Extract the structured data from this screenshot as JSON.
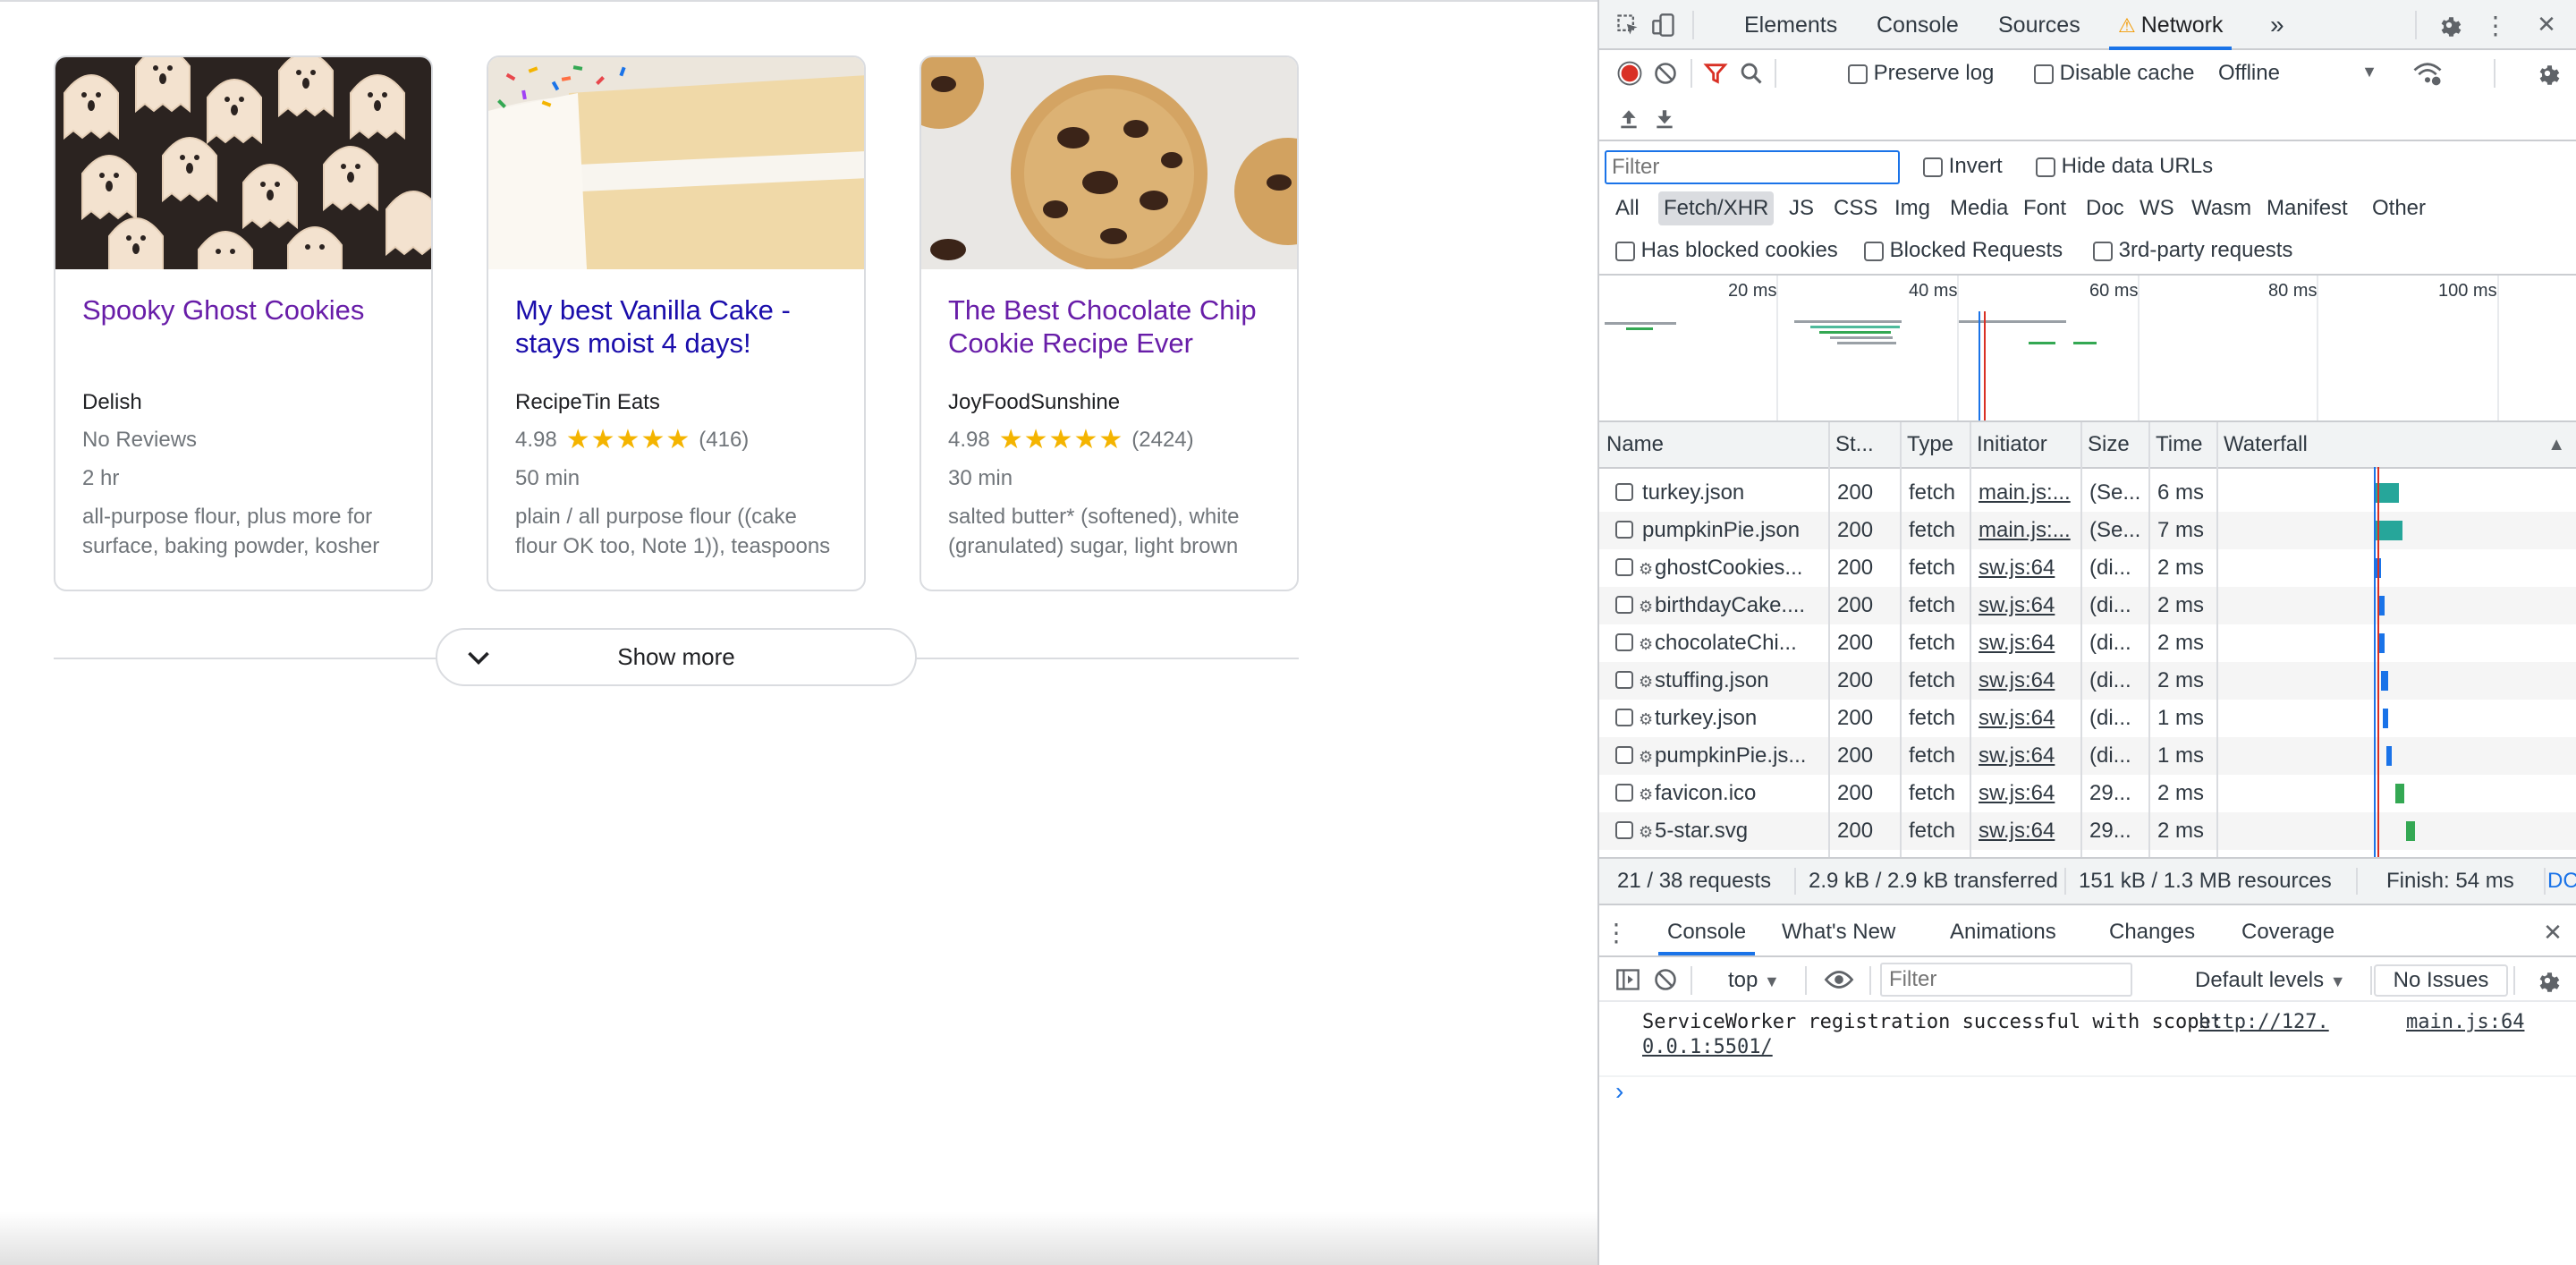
{
  "page": {
    "cards": [
      {
        "title": "Spooky Ghost Cookies",
        "source": "Delish",
        "rating_text": "No Reviews",
        "rating": null,
        "rating_count": "",
        "time": "2 hr",
        "desc": "all-purpose flour, plus more for surface, baking powder, kosher",
        "image": "ghost-cookies"
      },
      {
        "title": "My best Vanilla Cake - stays moist 4 days!",
        "source": "RecipeTin Eats",
        "rating_text": "4.98",
        "rating": 4.98,
        "rating_count": "(416)",
        "time": "50 min",
        "desc": "plain / all purpose flour ((cake flour OK too, Note 1)), teaspoons",
        "image": "vanilla-cake"
      },
      {
        "title": "The Best Chocolate Chip Cookie Recipe Ever",
        "source": "JoyFoodSunshine",
        "rating_text": "4.98",
        "rating": 4.98,
        "rating_count": "(2424)",
        "time": "30 min",
        "desc": "salted butter* (softened), white (granulated) sugar, light brown",
        "image": "chocolate-chip-cookie"
      }
    ],
    "show_more": "Show more"
  },
  "devtools": {
    "tabs": [
      "Elements",
      "Console",
      "Sources",
      "Network"
    ],
    "active_tab": "Network",
    "more_tabs": "»",
    "toolbar": {
      "preserve_log": "Preserve log",
      "disable_cache": "Disable cache",
      "throttle": "Offline"
    },
    "filter_placeholder": "Filter",
    "invert": "Invert",
    "hide_data_urls": "Hide data URLs",
    "types": [
      "All",
      "Fetch/XHR",
      "JS",
      "CSS",
      "Img",
      "Media",
      "Font",
      "Doc",
      "WS",
      "Wasm",
      "Manifest",
      "Other"
    ],
    "active_type": "Fetch/XHR",
    "checks": [
      "Has blocked cookies",
      "Blocked Requests",
      "3rd-party requests"
    ],
    "overview_ticks": [
      "20 ms",
      "40 ms",
      "60 ms",
      "80 ms",
      "100 ms"
    ],
    "columns": [
      "Name",
      "St...",
      "Type",
      "Initiator",
      "Size",
      "Time",
      "Waterfall"
    ],
    "rows": [
      {
        "name": "turkey.json",
        "status": "200",
        "type": "fetch",
        "initiator": "main.js:...",
        "size": "(Se...",
        "time": "6 ms",
        "sw": false
      },
      {
        "name": "pumpkinPie.json",
        "status": "200",
        "type": "fetch",
        "initiator": "main.js:...",
        "size": "(Se...",
        "time": "7 ms",
        "sw": false
      },
      {
        "name": "ghostCookies...",
        "status": "200",
        "type": "fetch",
        "initiator": "sw.js:64",
        "size": "(di...",
        "time": "2 ms",
        "sw": true
      },
      {
        "name": "birthdayCake....",
        "status": "200",
        "type": "fetch",
        "initiator": "sw.js:64",
        "size": "(di...",
        "time": "2 ms",
        "sw": true
      },
      {
        "name": "chocolateChi...",
        "status": "200",
        "type": "fetch",
        "initiator": "sw.js:64",
        "size": "(di...",
        "time": "2 ms",
        "sw": true
      },
      {
        "name": "stuffing.json",
        "status": "200",
        "type": "fetch",
        "initiator": "sw.js:64",
        "size": "(di...",
        "time": "2 ms",
        "sw": true
      },
      {
        "name": "turkey.json",
        "status": "200",
        "type": "fetch",
        "initiator": "sw.js:64",
        "size": "(di...",
        "time": "1 ms",
        "sw": true
      },
      {
        "name": "pumpkinPie.js...",
        "status": "200",
        "type": "fetch",
        "initiator": "sw.js:64",
        "size": "(di...",
        "time": "1 ms",
        "sw": true
      },
      {
        "name": "favicon.ico",
        "status": "200",
        "type": "fetch",
        "initiator": "sw.js:64",
        "size": "29...",
        "time": "2 ms",
        "sw": true
      },
      {
        "name": "5-star.svg",
        "status": "200",
        "type": "fetch",
        "initiator": "sw.js:64",
        "size": "29...",
        "time": "2 ms",
        "sw": true
      }
    ],
    "status_bar": {
      "requests": "21 / 38 requests",
      "transferred": "2.9 kB / 2.9 kB transferred",
      "resources": "151 kB / 1.3 MB resources",
      "finish": "Finish: 54 ms",
      "dcl": "DC"
    },
    "drawer": {
      "tabs": [
        "Console",
        "What's New",
        "Animations",
        "Changes",
        "Coverage"
      ],
      "active_tab": "Console",
      "context": "top",
      "filter_placeholder": "Filter",
      "levels": "Default levels",
      "issues": "No Issues",
      "message": "ServiceWorker registration successful with scope: ",
      "message_link": "http://127.0.0.1:5501/",
      "message_link_line1": "http://127.",
      "message_link_line2": "0.0.1:5501/",
      "message_source": "main.js:64",
      "prompt": "›"
    }
  },
  "colors": {
    "link": "#1a0dab",
    "visited": "#681da8",
    "accent": "#1a73e8",
    "star": "#f4b400",
    "record": "#d93025"
  }
}
